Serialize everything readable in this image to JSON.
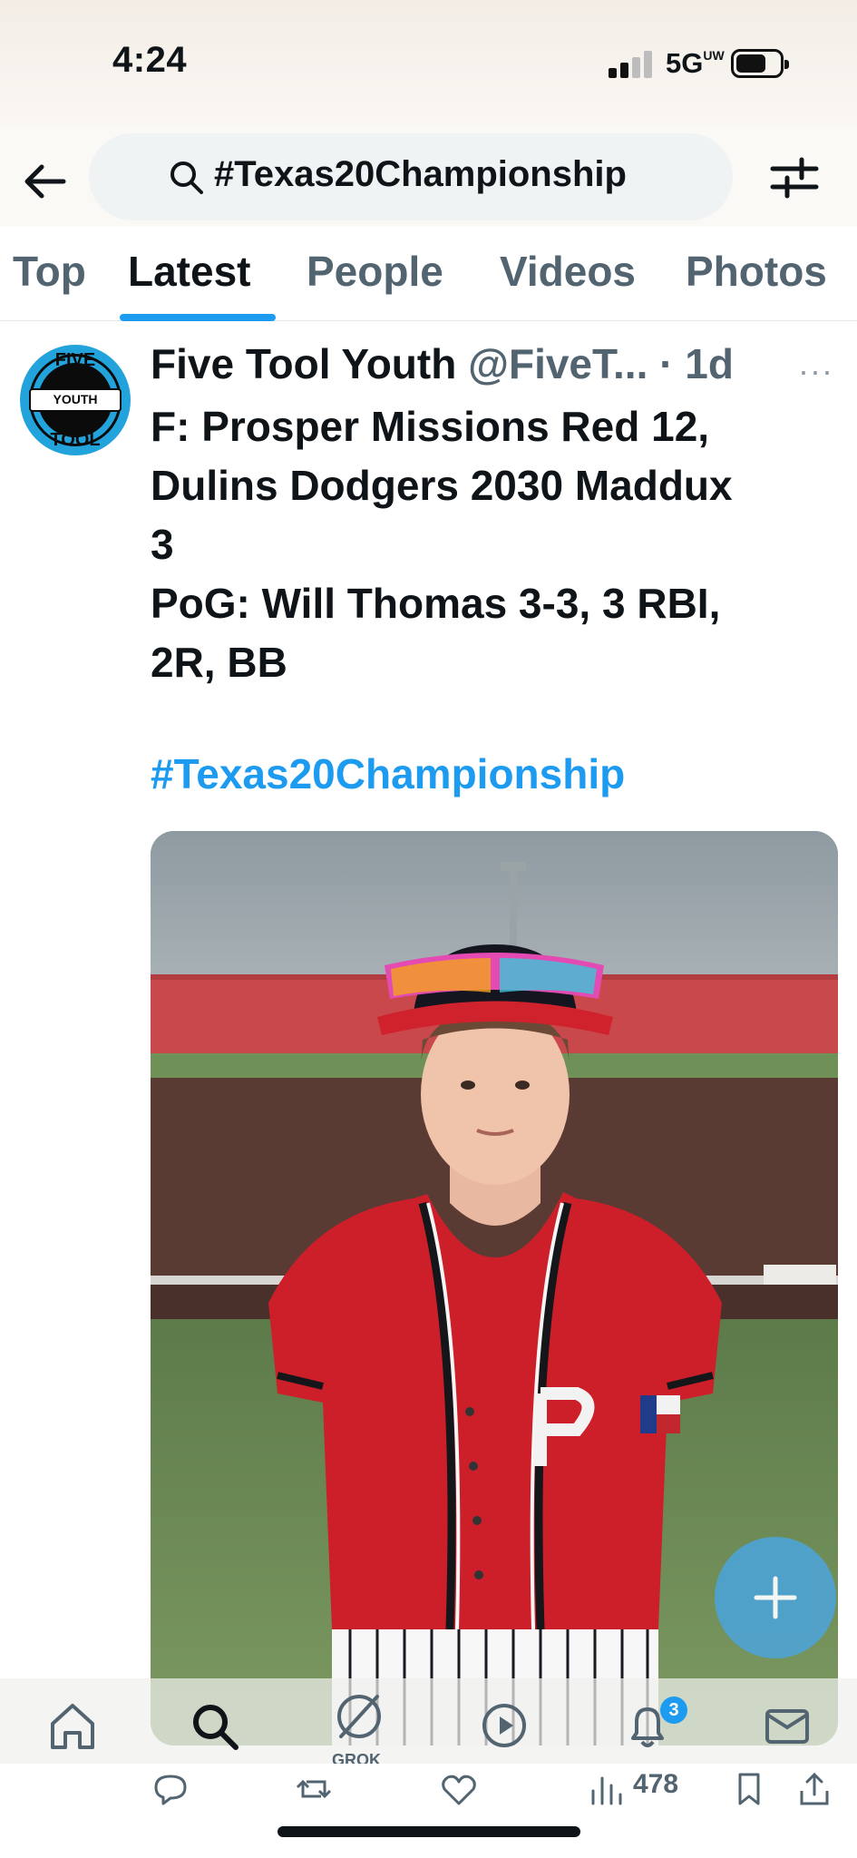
{
  "status_bar": {
    "time": "4:24",
    "network": "5G",
    "network_sup": "UW"
  },
  "search": {
    "query": "#Texas20Championship"
  },
  "tabs": [
    {
      "label": "Top",
      "active": false
    },
    {
      "label": "Latest",
      "active": true
    },
    {
      "label": "People",
      "active": false
    },
    {
      "label": "Videos",
      "active": false
    },
    {
      "label": "Photos",
      "active": false
    }
  ],
  "tweet": {
    "author_name": "Five Tool Youth",
    "author_handle": "@FiveT...",
    "time_sep": " · ",
    "time": "1d",
    "more": "···",
    "avatar_text": {
      "top": "FIVE",
      "center": "YOUTH",
      "bottom": "TOOL"
    },
    "text_lines": [
      "F: Prosper Missions Red 12,",
      "Dulins Dodgers 2030 Maddux",
      "3",
      "PoG: Will Thomas 3-3, 3 RBI,",
      "2R, BB"
    ],
    "hashtag": "#Texas20Championship",
    "views": "478"
  },
  "bottom_nav": {
    "items": [
      "home-icon",
      "search-icon",
      "grok-icon",
      "play-icon",
      "notifications-icon",
      "messages-icon"
    ],
    "grok_label": "GROK",
    "notification_badge": "3"
  },
  "colors": {
    "accent": "#1d9bf0",
    "text": "#0f1419",
    "secondary": "#536471"
  }
}
